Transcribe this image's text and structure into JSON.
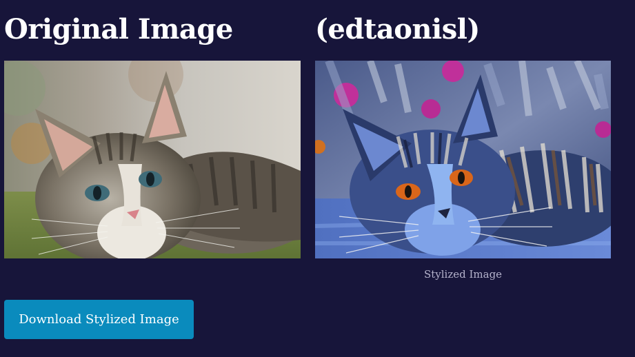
{
  "original": {
    "heading": "Original Image"
  },
  "stylized": {
    "heading": "(edtaonisl)",
    "caption": "Stylized Image"
  },
  "actions": {
    "download_label": "Download Stylized Image"
  },
  "colors": {
    "background": "#17153a",
    "button": "#0a8bbd",
    "caption": "#b5b3cc"
  }
}
